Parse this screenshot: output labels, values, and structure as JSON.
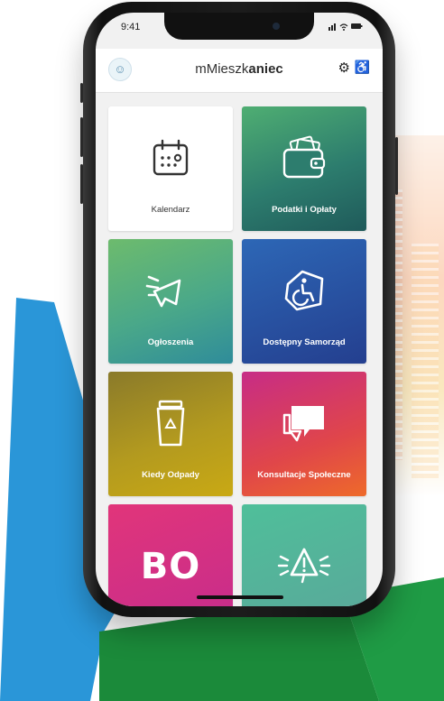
{
  "status_bar": {
    "time": "9:41",
    "icons": "▐▌◔ ▬"
  },
  "header": {
    "title_light": "mMieszk",
    "title_bold": "aniec"
  },
  "tiles": [
    {
      "label": "Kalendarz",
      "icon": "calendar-icon"
    },
    {
      "label": "Podatki i Opłaty",
      "icon": "wallet-icon"
    },
    {
      "label": "Ogłoszenia",
      "icon": "megaphone-icon"
    },
    {
      "label": "Dostępny Samorząd",
      "icon": "wheelchair-icon"
    },
    {
      "label": "Kiedy Odpady",
      "icon": "recycle-bin-icon"
    },
    {
      "label": "Konsultacje Społeczne",
      "icon": "speech-bubble-icon"
    },
    {
      "label": "BO",
      "icon": "bo-logo"
    },
    {
      "label": "",
      "icon": "alert-icon"
    }
  ],
  "colors": {
    "tile_green": "#2d7d6e",
    "tile_lime": "#4aa889",
    "tile_blue": "#243f8f",
    "tile_olive": "#b39a1f",
    "tile_pink": "#e0464a",
    "tile_magenta": "#c62c8c",
    "tile_teal": "#5aa79a",
    "bg_blue": "#2a96d8",
    "bg_green": "#1b8a3a"
  }
}
